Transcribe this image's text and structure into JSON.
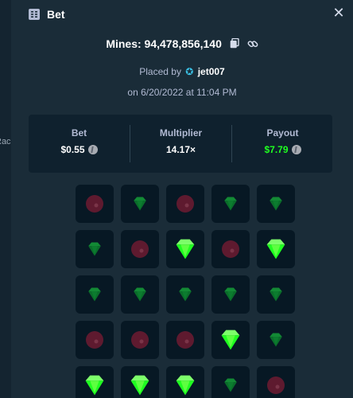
{
  "background": {
    "partial_label": "Rac"
  },
  "modal": {
    "title": "Bet",
    "title_icon": "receipt-icon",
    "close_icon": "close-icon"
  },
  "bet": {
    "mines_text": "Mines: 94,478,856,140",
    "copy_icon": "copy-icon",
    "link_icon": "link-icon",
    "placed_by_label": "Placed by",
    "user": "jet007",
    "user_badge_icon": "star-badge-icon",
    "date_text": "on 6/20/2022 at 11:04 PM"
  },
  "stats": {
    "bet_label": "Bet",
    "bet_value": "$0.55",
    "multiplier_label": "Multiplier",
    "multiplier_value": "14.17×",
    "payout_label": "Payout",
    "payout_value": "$7.79",
    "currency_icon": "litecoin-icon",
    "payout_color": "#1fff20"
  },
  "board": {
    "rows": [
      [
        "mine",
        "gem",
        "mine",
        "gem",
        "gem"
      ],
      [
        "gem",
        "mine",
        "gem-revealed",
        "mine",
        "gem-revealed"
      ],
      [
        "gem",
        "gem",
        "gem",
        "gem",
        "gem"
      ],
      [
        "mine",
        "mine",
        "mine",
        "gem-revealed",
        "gem"
      ],
      [
        "gem-revealed",
        "gem-revealed",
        "gem-revealed",
        "gem",
        "mine"
      ]
    ],
    "colors": {
      "gem": "#0a6e2a",
      "gem_revealed": "#1fff20",
      "mine": "#5e1a2f",
      "tile": "#071824"
    }
  }
}
